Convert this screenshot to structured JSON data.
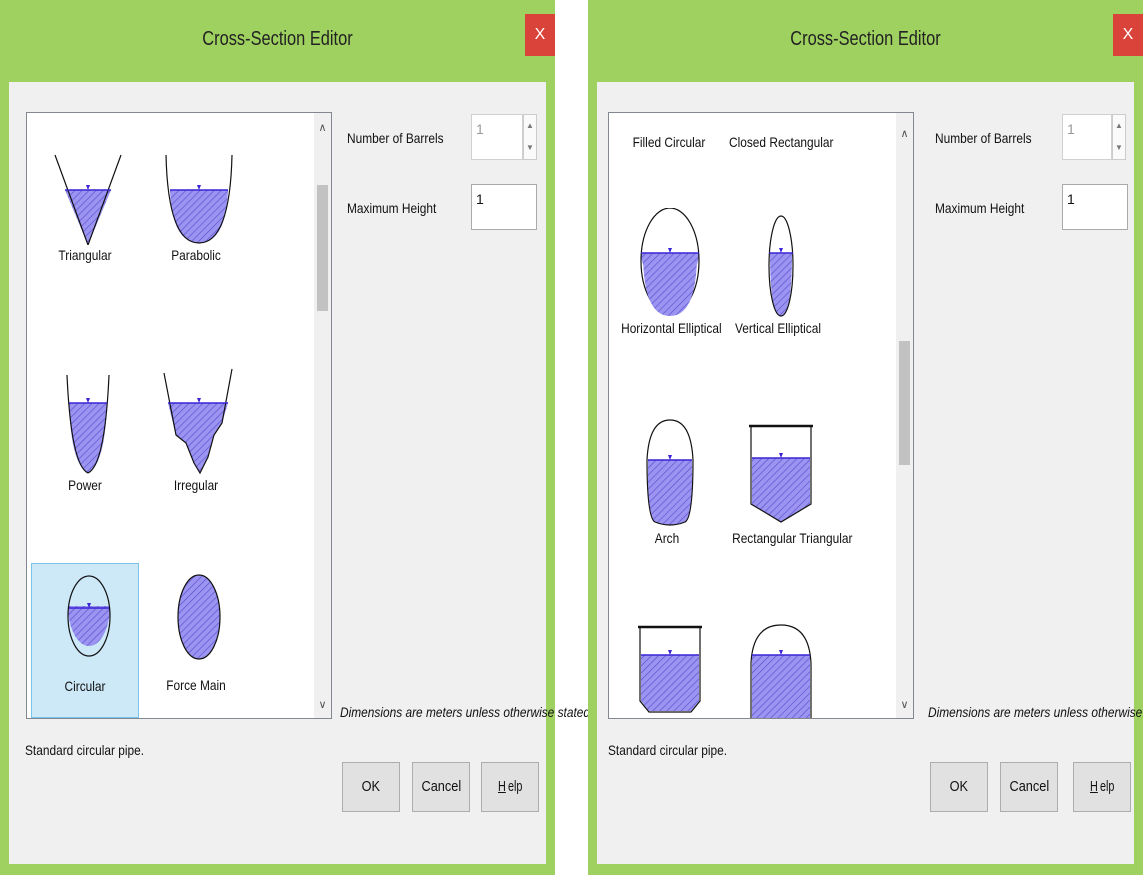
{
  "left": {
    "title": "Cross-Section Editor",
    "close_label": "X",
    "items": [
      "Triangular",
      "Parabolic",
      "Power",
      "Irregular",
      "Circular",
      "Force Main"
    ],
    "selected": "Circular",
    "barrels_label": "Number of Barrels",
    "barrels_value": "1",
    "height_label": "Maximum Height",
    "height_value": "1",
    "note": "Dimensions are meters unless otherwise stated.",
    "description": "Standard circular pipe.",
    "ok": "OK",
    "cancel": "Cancel",
    "help_mnemonic": "H",
    "help_rest": "elp"
  },
  "right": {
    "title": "Cross-Section Editor",
    "close_label": "X",
    "top_items": [
      "Filled Circular",
      "Closed Rectangular"
    ],
    "items": [
      "Horizontal Elliptical",
      "Vertical Elliptical",
      "Arch",
      "Rectangular Triangular"
    ],
    "barrels_label": "Number of Barrels",
    "barrels_value": "1",
    "height_label": "Maximum Height",
    "height_value": "1",
    "note": "Dimensions are meters unless otherwise stated.",
    "description": "Standard circular pipe.",
    "ok": "OK",
    "cancel": "Cancel",
    "help_mnemonic": "H",
    "help_rest": "elp"
  },
  "colors": {
    "frame": "#9fd160",
    "close": "#d9433a",
    "fill": "#9b94f0",
    "selection": "#cde8f7"
  },
  "icons": [
    "triangular-shape",
    "parabolic-shape",
    "power-shape",
    "irregular-shape",
    "circular-shape",
    "force-main-shape",
    "horizontal-elliptical-shape",
    "vertical-elliptical-shape",
    "arch-shape",
    "rectangular-triangular-shape"
  ]
}
